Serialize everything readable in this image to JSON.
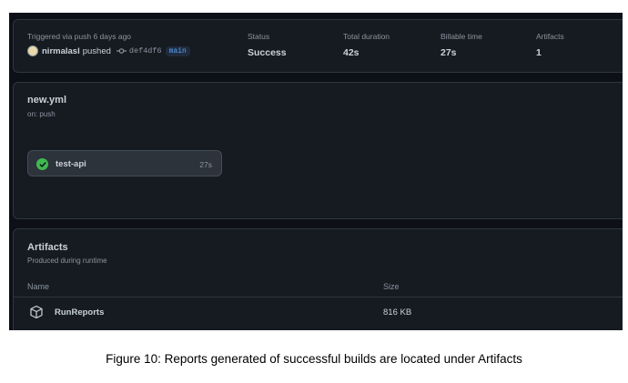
{
  "summary": {
    "trigger_label": "Triggered via push 6 days ago",
    "actor": "nirmalasl",
    "action": "pushed",
    "commit_sha": "def4df6",
    "branch": "main",
    "status_label": "Status",
    "status_value": "Success",
    "duration_label": "Total duration",
    "duration_value": "42s",
    "billable_label": "Billable time",
    "billable_value": "27s",
    "artifacts_label": "Artifacts",
    "artifacts_value": "1"
  },
  "workflow": {
    "name": "new.yml",
    "trigger": "on: push",
    "job": {
      "name": "test-api",
      "duration": "27s",
      "status": "success"
    }
  },
  "artifacts": {
    "title": "Artifacts",
    "subtitle": "Produced during runtime",
    "columns": {
      "name": "Name",
      "size": "Size"
    },
    "rows": [
      {
        "name": "RunReports",
        "size": "816 KB"
      }
    ]
  },
  "caption": "Figure 10: Reports generated of successful builds are located under Artifacts",
  "colors": {
    "background": "#0d1117",
    "panel": "#161b22",
    "border": "#30363d",
    "text": "#c9d1d9",
    "muted": "#8b949e",
    "success": "#3fb950",
    "link": "#58a6ff"
  },
  "icons": {
    "avatar": "user-avatar",
    "commit": "git-commit-icon",
    "job_status": "check-circle-icon",
    "artifact": "package-icon"
  }
}
